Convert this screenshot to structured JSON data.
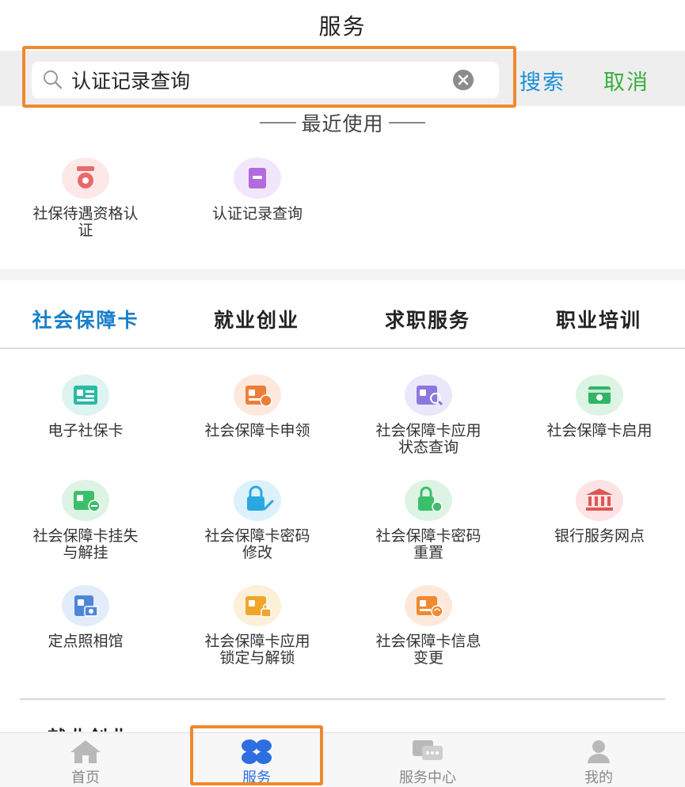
{
  "header": {
    "title": "服务"
  },
  "search": {
    "value": "认证记录查询",
    "search_label": "搜索",
    "cancel_label": "取消"
  },
  "recent": {
    "heading": "最近使用",
    "items": [
      {
        "label": "社保待遇资格认证",
        "icon": "medal-icon"
      },
      {
        "label": "认证记录查询",
        "icon": "record-card-icon"
      }
    ]
  },
  "tabs": [
    "社会保障卡",
    "就业创业",
    "求职服务",
    "职业培训"
  ],
  "services": [
    {
      "label": "电子社保卡",
      "icon": "id-card-icon"
    },
    {
      "label": "社会保障卡申领",
      "icon": "card-apply-icon"
    },
    {
      "label": "社会保障卡应用状态查询",
      "icon": "card-search-icon"
    },
    {
      "label": "社会保障卡启用",
      "icon": "card-enable-icon"
    },
    {
      "label": "社会保障卡挂失与解挂",
      "icon": "card-loss-icon"
    },
    {
      "label": "社会保障卡密码修改",
      "icon": "password-edit-icon"
    },
    {
      "label": "社会保障卡密码重置",
      "icon": "password-reset-icon"
    },
    {
      "label": "银行服务网点",
      "icon": "bank-icon"
    },
    {
      "label": "定点照相馆",
      "icon": "photo-studio-icon"
    },
    {
      "label": "社会保障卡应用锁定与解锁",
      "icon": "card-lock-icon"
    },
    {
      "label": "社会保障卡信息变更",
      "icon": "card-info-change-icon"
    }
  ],
  "next_section_peek": "就业创业",
  "tabbar": [
    {
      "label": "首页",
      "icon": "home-icon"
    },
    {
      "label": "服务",
      "icon": "services-grid-icon"
    },
    {
      "label": "服务中心",
      "icon": "chat-center-icon"
    },
    {
      "label": "我的",
      "icon": "profile-icon"
    }
  ],
  "colors": {
    "accent_blue": "#1a7fc8",
    "search_blue": "#1a8fd8",
    "cancel_green": "#3aae3a",
    "highlight_orange": "#ee8a2e"
  }
}
